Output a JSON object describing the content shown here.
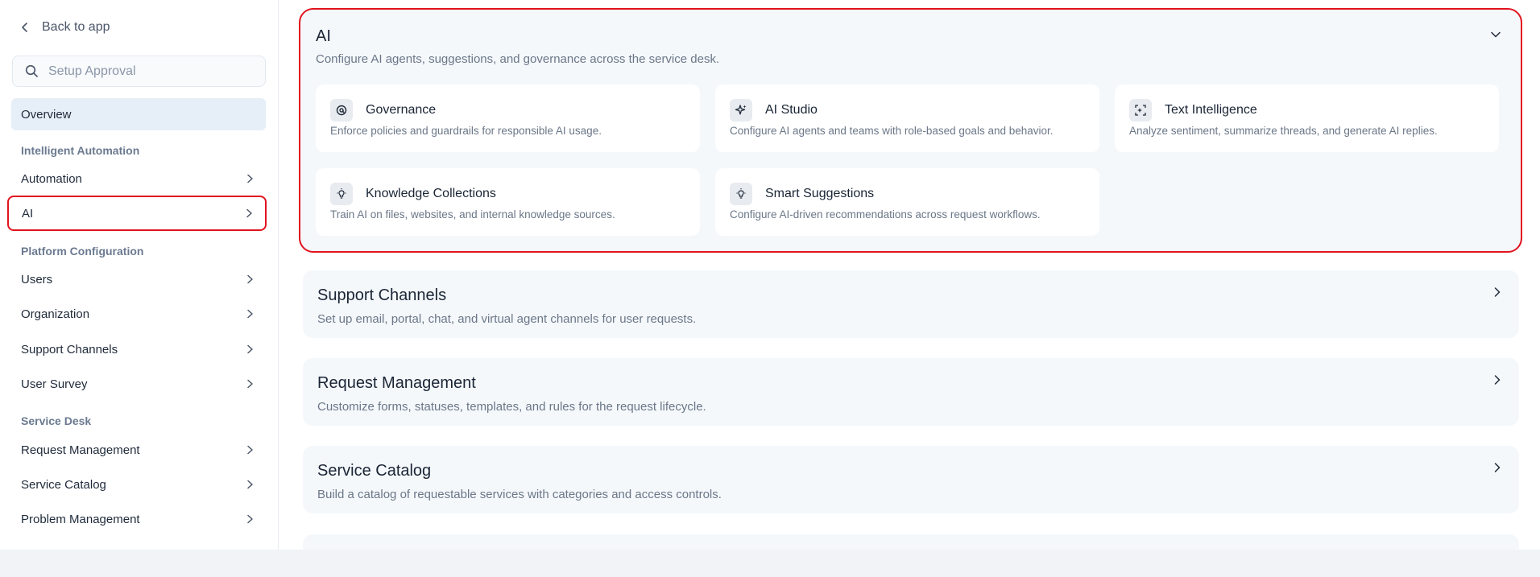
{
  "sidebar": {
    "back_label": "Back to app",
    "search_placeholder": "Setup Approval",
    "overview": "Overview",
    "sections": {
      "intelligent_automation": "Intelligent Automation",
      "platform_configuration": "Platform Configuration",
      "service_desk": "Service Desk"
    },
    "items": {
      "automation": "Automation",
      "ai": "AI",
      "users": "Users",
      "organization": "Organization",
      "support_channels": "Support Channels",
      "user_survey": "User Survey",
      "request_management": "Request Management",
      "service_catalog": "Service Catalog",
      "problem_management": "Problem Management"
    }
  },
  "main": {
    "ai": {
      "title": "AI",
      "description": "Configure AI agents, suggestions, and governance across the service desk.",
      "cards": [
        {
          "title": "Governance",
          "description": "Enforce policies and guardrails for responsible AI usage.",
          "icon": "governance-icon"
        },
        {
          "title": "AI Studio",
          "description": "Configure AI agents and teams with role-based goals and behavior.",
          "icon": "sparkle-icon"
        },
        {
          "title": "Text Intelligence",
          "description": "Analyze sentiment, summarize threads, and generate AI replies.",
          "icon": "text-scan-icon"
        },
        {
          "title": "Knowledge Collections",
          "description": "Train AI on files, websites, and internal knowledge sources.",
          "icon": "lightbulb-icon"
        },
        {
          "title": "Smart Suggestions",
          "description": "Configure AI-driven recommendations across request workflows.",
          "icon": "lightbulb-icon"
        }
      ]
    },
    "panels": [
      {
        "title": "Support Channels",
        "description": "Set up email, portal, chat, and virtual agent channels for user requests."
      },
      {
        "title": "Request Management",
        "description": "Customize forms, statuses, templates, and rules for the request lifecycle."
      },
      {
        "title": "Service Catalog",
        "description": "Build a catalog of requestable services with categories and access controls."
      }
    ]
  },
  "colors": {
    "highlight": "#e1131e",
    "active_nav": "#e6eef7",
    "section_bg": "#f5f8fb"
  }
}
